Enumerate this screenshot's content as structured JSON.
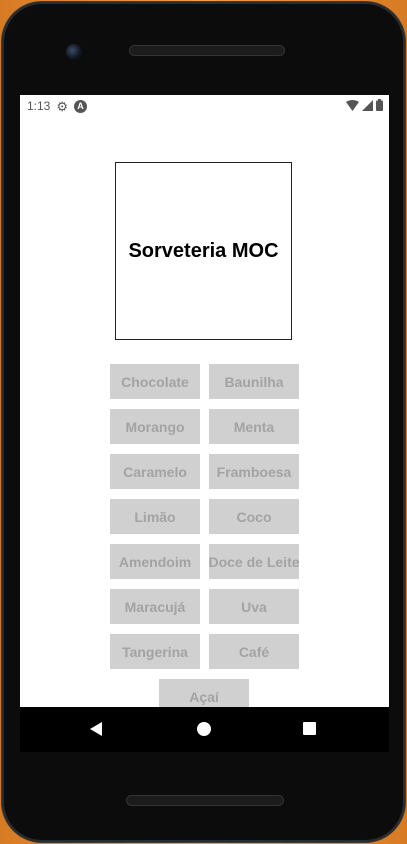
{
  "status_bar": {
    "time": "1:13",
    "icons": [
      "settings-icon",
      "android-icon",
      "wifi-icon",
      "signal-icon",
      "battery-icon"
    ]
  },
  "app": {
    "title": "Sorveteria MOC"
  },
  "flavors": [
    "Chocolate",
    "Baunilha",
    "Morango",
    "Menta",
    "Caramelo",
    "Framboesa",
    "Limão",
    "Coco",
    "Amendoim",
    "Doce de Leite",
    "Maracujá",
    "Uva",
    "Tangerina",
    "Café",
    "Açaí"
  ],
  "navigation": {
    "icons": [
      "back-icon",
      "home-icon",
      "recents-icon"
    ]
  },
  "colors": {
    "button_bg": "#d0d0d0",
    "button_text": "#a3a3a3",
    "screen_bg": "#ffffff",
    "device_body": "#0c0c0c"
  }
}
